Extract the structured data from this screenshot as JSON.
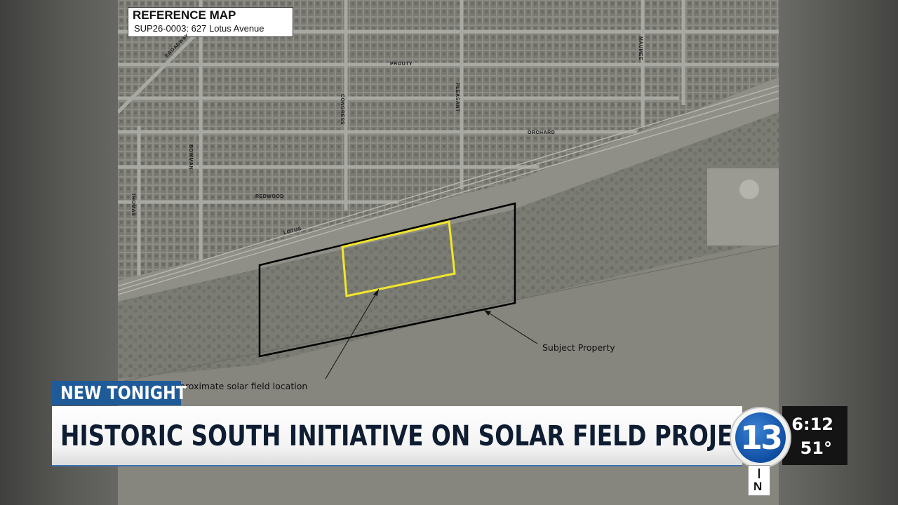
{
  "map": {
    "title": "REFERENCE MAP",
    "subtitle": "SUP26-0003: 627 Lotus Avenue",
    "streets": [
      "BROADWAY",
      "PROUTY",
      "MAUMEE",
      "CONGRESS",
      "PLEASANT",
      "ORCHARD",
      "BOWMAN",
      "THOMAS",
      "REDWOOD",
      "LOTUS"
    ],
    "annotations": {
      "subject_property": "Subject Property",
      "solar_field": "proximate solar field location"
    },
    "colors": {
      "solar_outline": "#f2e62a",
      "property_outline": "#000000"
    }
  },
  "lower_third": {
    "tag": "NEW TONIGHT",
    "headline": "HISTORIC SOUTH INITIATIVE ON SOLAR FIELD PROJECT"
  },
  "station": {
    "logo_number": "13",
    "time": "6:12",
    "temperature": "51°",
    "tab_letter": "N",
    "colors": {
      "brand_blue": "#1e5b98",
      "accent_blue": "#3c73b5"
    }
  }
}
